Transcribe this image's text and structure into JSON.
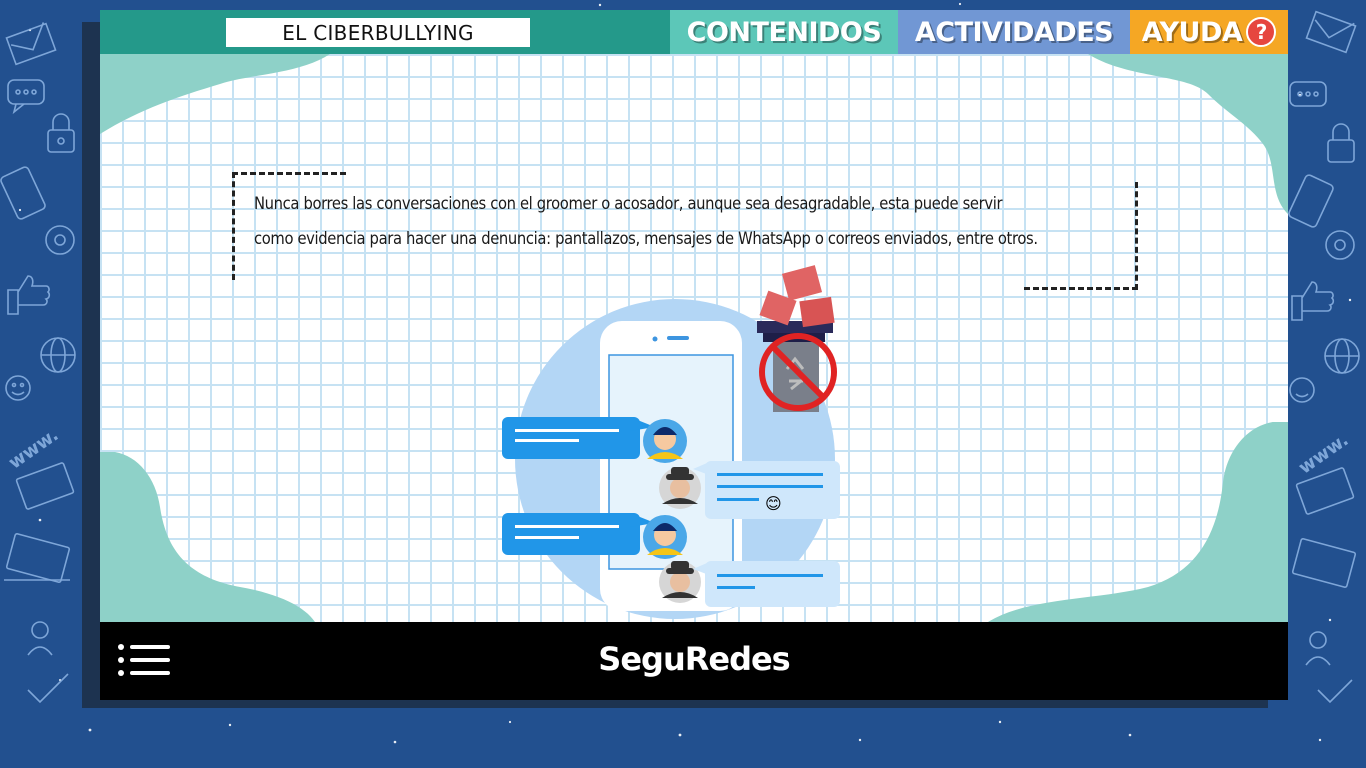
{
  "header": {
    "title": "EL CIBERBULLYING",
    "tabs": {
      "contenidos": "CONTENIDOS",
      "actividades": "ACTIVIDADES",
      "ayuda": "AYUDA",
      "ayuda_badge": "?"
    }
  },
  "main": {
    "paragraph_line1": "Nunca borres las conversaciones con el groomer o acosador, aunque sea desagradable, esta puede servir",
    "paragraph_line2": "como evidencia para hacer una denuncia: pantallazos, mensajes de WhatsApp o correos enviados, entre otros.",
    "illustration": {
      "icons": [
        "phone-icon",
        "chat-bubble-icon",
        "user-avatar-icon",
        "hacker-avatar-icon",
        "trash-bin-icon",
        "prohibited-icon",
        "image-icon",
        "smile-emoji-icon"
      ],
      "emoji": "😊"
    }
  },
  "footer": {
    "brand": "SeguRedes",
    "menu_icon": "hamburger-menu-icon"
  },
  "colors": {
    "background": "#22508f",
    "header": "#24998a",
    "tab_contenidos": "#5cc7b8",
    "tab_actividades": "#7197d4",
    "tab_ayuda": "#f5a724",
    "blob": "#8ed1c8",
    "footer": "#000000"
  }
}
